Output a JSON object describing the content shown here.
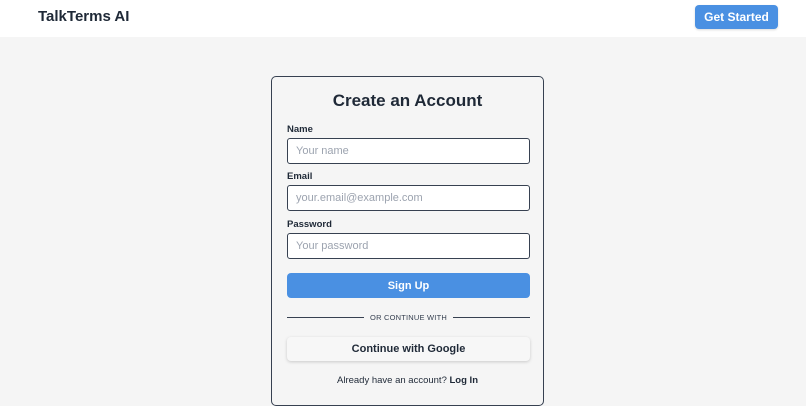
{
  "header": {
    "brand": "TalkTerms AI",
    "cta_label": "Get Started"
  },
  "signup_form": {
    "title": "Create an Account",
    "name": {
      "label": "Name",
      "placeholder": "Your name",
      "value": ""
    },
    "email": {
      "label": "Email",
      "placeholder": "your.email@example.com",
      "value": ""
    },
    "password": {
      "label": "Password",
      "placeholder": "Your password",
      "value": ""
    },
    "submit_label": "Sign Up",
    "divider_text": "OR CONTINUE WITH",
    "google_label": "Continue with Google",
    "login_prompt": "Already have an account?",
    "login_link": "Log In"
  },
  "colors": {
    "accent": "#4a90e2",
    "page_bg": "#f5f5f5",
    "header_bg": "#ffffff",
    "text": "#1f2937"
  }
}
